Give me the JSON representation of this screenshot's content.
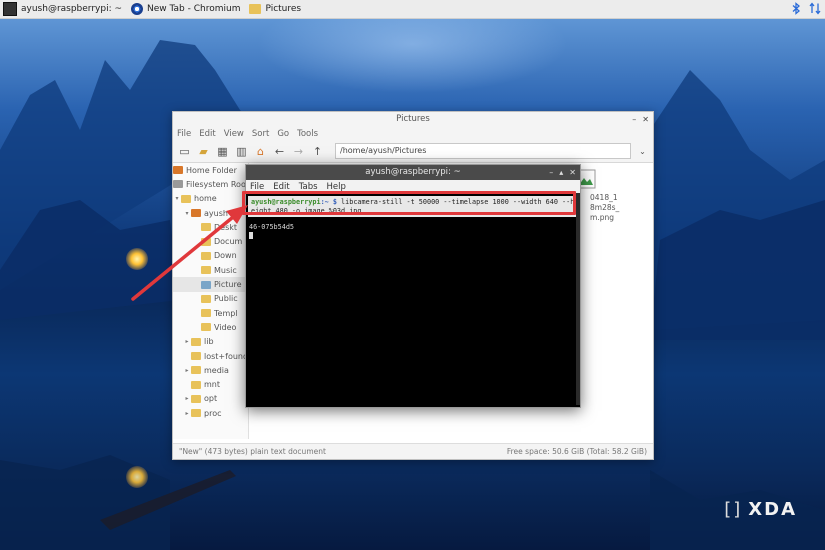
{
  "taskbar": {
    "items": [
      {
        "label": "ayush@raspberrypi: ~",
        "icon": "terminal-icon"
      },
      {
        "label": "New Tab - Chromium",
        "icon": "chromium-icon"
      },
      {
        "label": "Pictures",
        "icon": "folder-icon"
      }
    ],
    "tray": [
      "bluetooth-icon",
      "network-arrows-icon"
    ]
  },
  "file_manager": {
    "title": "Pictures",
    "menu": [
      "File",
      "Edit",
      "View",
      "Sort",
      "Go",
      "Tools"
    ],
    "path": "/home/ayush/Pictures",
    "sidebar": [
      {
        "label": "Home Folder",
        "icon": "home-icon"
      },
      {
        "label": "Filesystem Root",
        "icon": "drive-icon"
      },
      {
        "label": "home",
        "icon": "folder-icon"
      },
      {
        "label": "ayush",
        "icon": "home-icon"
      },
      {
        "label": "Deskt",
        "icon": "folder-icon"
      },
      {
        "label": "Docum",
        "icon": "folder-icon"
      },
      {
        "label": "Down",
        "icon": "folder-icon"
      },
      {
        "label": "Music",
        "icon": "folder-icon"
      },
      {
        "label": "Picture",
        "icon": "folder-icon"
      },
      {
        "label": "Public",
        "icon": "folder-icon"
      },
      {
        "label": "Templ",
        "icon": "folder-icon"
      },
      {
        "label": "Video",
        "icon": "folder-icon"
      },
      {
        "label": "lib",
        "icon": "folder-icon"
      },
      {
        "label": "lost+found",
        "icon": "folder-icon"
      },
      {
        "label": "media",
        "icon": "folder-icon"
      },
      {
        "label": "mnt",
        "icon": "folder-icon"
      },
      {
        "label": "opt",
        "icon": "folder-icon"
      },
      {
        "label": "proc",
        "icon": "folder-icon"
      }
    ],
    "file": {
      "line1": "0418_1",
      "line2": "8m28s_",
      "line3": "m.png"
    },
    "status_left": "\"New\" (473 bytes) plain text document",
    "status_right": "Free space: 50.6 GiB (Total: 58.2 GiB)"
  },
  "terminal": {
    "title": "ayush@raspberrypi: ~",
    "menu": [
      "File",
      "Edit",
      "Tabs",
      "Help"
    ],
    "prompt_user": "ayush@raspberrypi",
    "prompt_path": ":~ $",
    "command": " libcamera-still -t 50000 --timelapse 1000 --width 640 --height 480 -o image_%03d.jpg",
    "output_line": "46-075b54d5"
  },
  "watermark": {
    "brand": "XDA",
    "bracket": "[]"
  },
  "colors": {
    "highlight": "#e0383b",
    "prompt_user": "#3a8c2a",
    "terminal_bg": "#000000"
  }
}
